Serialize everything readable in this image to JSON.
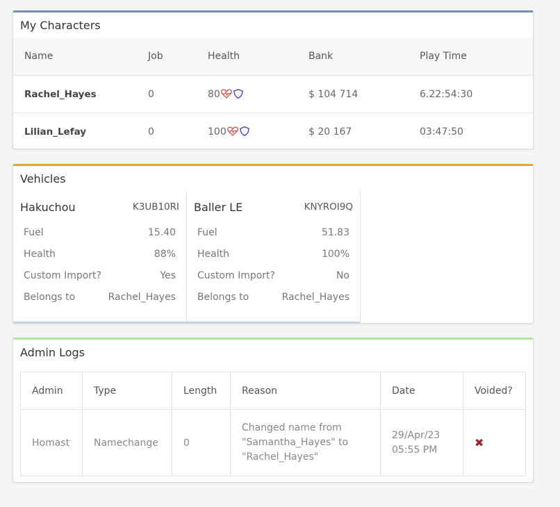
{
  "characters": {
    "title": "My Characters",
    "headers": {
      "name": "Name",
      "job": "Job",
      "health": "Health",
      "bank": "Bank",
      "play": "Play Time"
    },
    "rows": [
      {
        "name": "Rachel_Hayes",
        "job": "0",
        "health": "80",
        "bank": "$ 104 714",
        "play": "6.22:54:30"
      },
      {
        "name": "Lilian_Lefay",
        "job": "0",
        "health": "100",
        "bank": "$ 20 167",
        "play": "03:47:50"
      }
    ],
    "icons": {
      "heart": "heartbeat-icon",
      "armor": "shield-icon"
    },
    "colors": {
      "heart": "#d9534f",
      "armor": "#5b3fd6",
      "accent": "#6e8fbf"
    }
  },
  "vehicles": {
    "title": "Vehicles",
    "labels": {
      "fuel": "Fuel",
      "health": "Health",
      "custom": "Custom Import?",
      "owner": "Belongs to"
    },
    "items": [
      {
        "name": "Hakuchou",
        "plate": "K3UB10RI",
        "fuel": "15.40",
        "health": "88%",
        "custom": "Yes",
        "owner": "Rachel_Hayes"
      },
      {
        "name": "Baller LE",
        "plate": "KNYROI9Q",
        "fuel": "51.83",
        "health": "100%",
        "custom": "No",
        "owner": "Rachel_Hayes"
      }
    ],
    "colors": {
      "accent": "#e0a53a"
    }
  },
  "logs": {
    "title": "Admin Logs",
    "headers": {
      "admin": "Admin",
      "type": "Type",
      "length": "Length",
      "reason": "Reason",
      "date": "Date",
      "voided": "Voided?"
    },
    "rows": [
      {
        "admin": "Homast",
        "type": "Namechange",
        "length": "0",
        "reason_lines": [
          "Changed name from",
          "\"Samantha_Hayes\" to",
          "\"Rachel_Hayes\""
        ],
        "date_lines": [
          "29/Apr/23",
          "05:55 PM"
        ],
        "voided": "✖"
      }
    ],
    "colors": {
      "accent": "#aee6a0",
      "voided_no": "#a02424"
    }
  }
}
